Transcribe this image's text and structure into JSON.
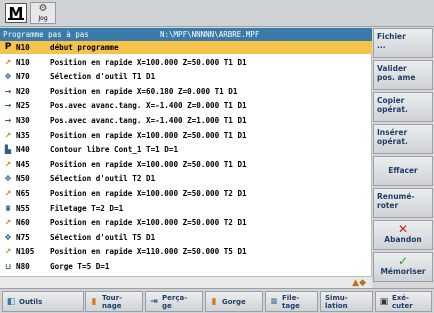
{
  "header": {
    "mode": "M",
    "jog_label": "Jog",
    "program_mode": "Programme pas à pas",
    "program_path": "N:\\MPF\\NNNNN\\ARBRE.MPF"
  },
  "program": {
    "rows": [
      {
        "icon": "P",
        "block": "N10",
        "text": "début programme"
      },
      {
        "icon": "tool-move-icon",
        "block": "N10",
        "text": "Position en rapide  X=100.000  Z=50.000  T1 D1"
      },
      {
        "icon": "tool-select-icon",
        "block": "N70",
        "text": "Sélection d'outil  T1 D1"
      },
      {
        "icon": "line-icon",
        "block": "N20",
        "text": "Position en rapide  X=60.180  Z=0.000   T1 D1"
      },
      {
        "icon": "line-icon",
        "block": "N25",
        "text": "Pos.avec avanc.tang.  X=-1.400  Z=0.000  T1 D1"
      },
      {
        "icon": "line-icon",
        "block": "N30",
        "text": "Pos.avec avanc.tang.  X=-1.400  Z=1.000  T1 D1"
      },
      {
        "icon": "tool-move-icon",
        "block": "N35",
        "text": "Position en rapide  X=100.000  Z=50.000  T1 D1"
      },
      {
        "icon": "contour-icon",
        "block": "N40",
        "text": "Contour libre Cont_1  T=1 D=1"
      },
      {
        "icon": "tool-move-icon",
        "block": "N45",
        "text": "Position en rapide  X=100.000  Z=50.000  T1 D1"
      },
      {
        "icon": "tool-select-icon",
        "block": "N50",
        "text": "Sélection d'outil  T2 D1"
      },
      {
        "icon": "tool-move-icon",
        "block": "N65",
        "text": "Position en rapide  X=100.000  Z=50.000  T2 D1"
      },
      {
        "icon": "thread-icon",
        "block": "N55",
        "text": "Filetage  T=2 D=1"
      },
      {
        "icon": "tool-move-icon",
        "block": "N60",
        "text": "Position en rapide  X=100.000  Z=50.000  T2 D1"
      },
      {
        "icon": "tool-select-icon",
        "block": "N75",
        "text": "Sélection d'outil  T5 D1"
      },
      {
        "icon": "tool-move-icon",
        "block": "N105",
        "text": "Position en rapide  X=110.000  Z=50.000  T5 D1"
      },
      {
        "icon": "groove-icon",
        "block": "N80",
        "text": "Gorge  T=5 D=1"
      }
    ],
    "selected_index": 0
  },
  "softkeys_right": [
    {
      "label": "Fichier",
      "sub": "...",
      "icon": ""
    },
    {
      "label": "Valider",
      "sub": "pos. ame",
      "icon": ""
    },
    {
      "label": "Copier",
      "sub": "opérat.",
      "icon": ""
    },
    {
      "label": "Insérer",
      "sub": "opérat.",
      "icon": ""
    },
    {
      "label": "Effacer",
      "sub": "",
      "icon": ""
    },
    {
      "label": "Renumé-",
      "sub": "roter",
      "icon": ""
    },
    {
      "label": "Abandon",
      "sub": "",
      "icon": "x"
    },
    {
      "label": "Mémoriser",
      "sub": "",
      "icon": "ok"
    }
  ],
  "softkeys_bottom": [
    {
      "label": "Outils",
      "sub": ""
    },
    {
      "label": "Tour-",
      "sub": "nage"
    },
    {
      "label": "Perça-",
      "sub": "ge"
    },
    {
      "label": "Gorge",
      "sub": ""
    },
    {
      "label": "File-",
      "sub": "tage"
    },
    {
      "label": "Simu-",
      "sub": "lation"
    },
    {
      "label": "Exé-",
      "sub": "cuter"
    }
  ],
  "colors": {
    "selected_row": "#f5c24c",
    "header_bar": "#3a7aa8",
    "softkey_text": "#1f3e66"
  }
}
